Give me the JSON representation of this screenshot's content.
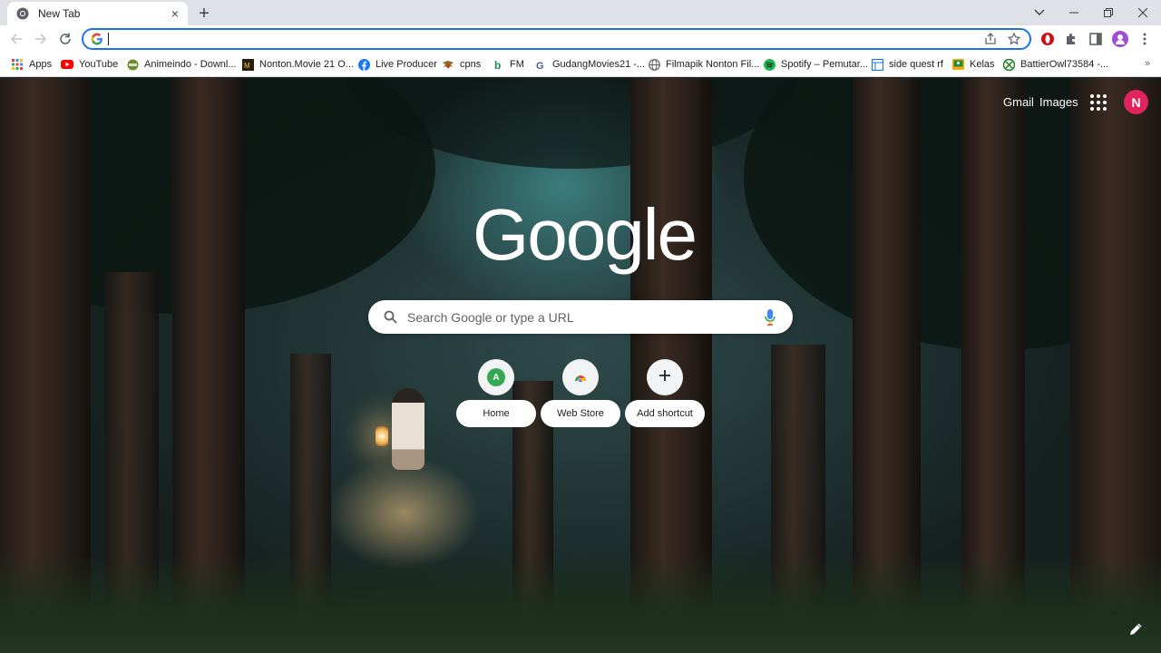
{
  "tab": {
    "title": "New Tab",
    "close_label": "×"
  },
  "newtab_label": "+",
  "omnibox": {
    "value": "",
    "placeholder": ""
  },
  "bookmarks": [
    {
      "label": "Apps",
      "icon": "apps-grid-icon",
      "color": "#ea4335"
    },
    {
      "label": "YouTube",
      "icon": "youtube-icon",
      "color": "#ff0000"
    },
    {
      "label": "Animeindo - Downl...",
      "icon": "animeindo-icon",
      "color": "#6b8e23"
    },
    {
      "label": "Nonton.Movie 21 O...",
      "icon": "nonton-icon",
      "color": "#3a2a10"
    },
    {
      "label": "Live Producer",
      "icon": "facebook-icon",
      "color": "#1877f2"
    },
    {
      "label": "cpns",
      "icon": "garuda-icon",
      "color": "#8a6a20"
    },
    {
      "label": "FM",
      "icon": "b-icon",
      "color": "#1f8f4f"
    },
    {
      "label": "GudangMovies21 -...",
      "icon": "g-icon",
      "color": "#4a5a9a"
    },
    {
      "label": "Filmapik Nonton Fil...",
      "icon": "globe-icon",
      "color": "#5f6368"
    },
    {
      "label": "Spotify – Pemutar...",
      "icon": "spotify-icon",
      "color": "#1db954"
    },
    {
      "label": "side quest rf",
      "icon": "page-icon",
      "color": "#1a73e8"
    },
    {
      "label": "Kelas",
      "icon": "classroom-icon",
      "color": "#f9ab00"
    },
    {
      "label": "BattierOwl73584 -...",
      "icon": "xbox-icon",
      "color": "#107c10"
    }
  ],
  "bookmarks_more": "»",
  "header": {
    "gmail": "Gmail",
    "images": "Images",
    "avatar_letter": "N"
  },
  "logo": "Google",
  "search": {
    "placeholder": "Search Google or type a URL"
  },
  "shortcuts": [
    {
      "label": "Home",
      "icon": "letter-a-icon",
      "letter": "A"
    },
    {
      "label": "Web Store",
      "icon": "chrome-web-store-icon"
    },
    {
      "label": "Add shortcut",
      "icon": "plus-icon"
    }
  ],
  "colors": {
    "accent": "#1a73e8",
    "avatar": "#e0245e"
  }
}
